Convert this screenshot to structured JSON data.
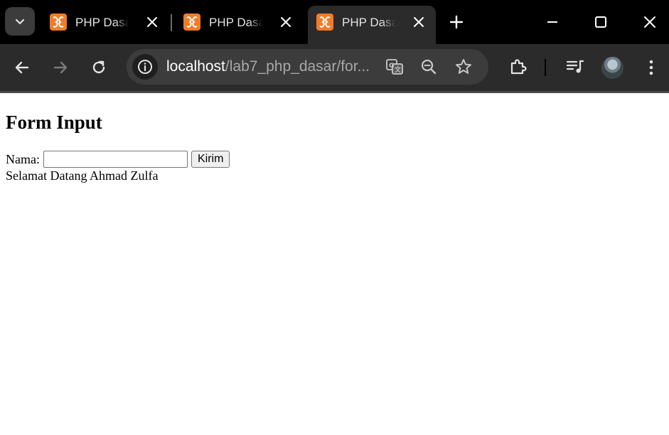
{
  "browser": {
    "tabs": [
      {
        "title": "PHP Dasar",
        "active": false
      },
      {
        "title": "PHP Dasar",
        "active": false
      },
      {
        "title": "PHP Dasar",
        "active": true
      }
    ],
    "url_host": "localhost",
    "url_path": "/lab7_php_dasar/for...",
    "colors": {
      "tabstrip": "#000000",
      "toolbar": "#2b2b2b",
      "omnibox": "#3c3c3c",
      "favicon": "#f07c2a"
    }
  },
  "page": {
    "heading": "Form Input",
    "name_label": "Nama:",
    "name_value": "",
    "submit_label": "Kirim",
    "greeting": "Selamat Datang Ahmad Zulfa"
  }
}
